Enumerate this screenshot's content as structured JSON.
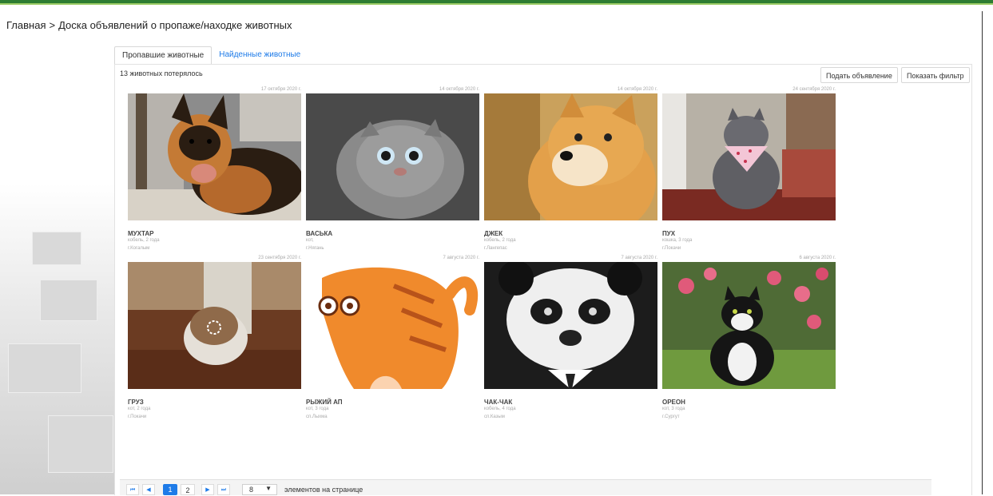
{
  "breadcrumb": {
    "home": "Главная",
    "separator": ">",
    "current": "Доска объявлений о пропаже/находке животных"
  },
  "tabs": [
    {
      "label": "Пропавшие животные",
      "active": true
    },
    {
      "label": "Найденные животные",
      "active": false
    }
  ],
  "summary": {
    "count_text": "13 животных потерялось"
  },
  "toolbar": {
    "submit_label": "Подать объявление",
    "filter_label": "Показать фильтр"
  },
  "cards": [
    {
      "date": "17 октября 2020 г.",
      "name": "МУХТАР",
      "info": "кобель, 2 года",
      "city": "г.Когалым",
      "image": "german-shepherd-photo"
    },
    {
      "date": "14 октября 2020 г.",
      "name": "ВАСЬКА",
      "info": "кот,",
      "city": "г.Нягань",
      "image": "scottish-fold-cat-photo"
    },
    {
      "date": "14 октября 2020 г.",
      "name": "ДЖЕК",
      "info": "кобель, 2 года",
      "city": "г.Лангепас",
      "image": "shiba-inu-photo"
    },
    {
      "date": "24 сентября 2020 г.",
      "name": "ПУХ",
      "info": "кошка, 3 года",
      "city": "г.Покачи",
      "image": "fat-cat-with-bandana-photo"
    },
    {
      "date": "23 сентября 2020 г.",
      "name": "ГРУЗ",
      "info": "кот, 2 года",
      "city": "г.Покачи",
      "image": "cat-loading-photo"
    },
    {
      "date": "7 августа 2020 г.",
      "name": "РЫЖИЙ АП",
      "info": "кот, 3 года",
      "city": "сп.Лыхма",
      "image": "orange-cartoon-cat"
    },
    {
      "date": "7 августа 2020 г.",
      "name": "ЧАК-ЧАК",
      "info": "кобель, 4 года",
      "city": "сп.Казым",
      "image": "panda-in-suit-drawing"
    },
    {
      "date": "6 августа 2020 г.",
      "name": "ОРЕОН",
      "info": "кот, 3 года",
      "city": "г.Сургут",
      "image": "tuxedo-cat-photo"
    }
  ],
  "pager": {
    "pages": [
      "1",
      "2"
    ],
    "current_page": "1",
    "page_size": "8",
    "page_size_label": "элементов на странице"
  },
  "colors": {
    "accent": "#1e7be8",
    "topbar": "#2e7d32"
  }
}
